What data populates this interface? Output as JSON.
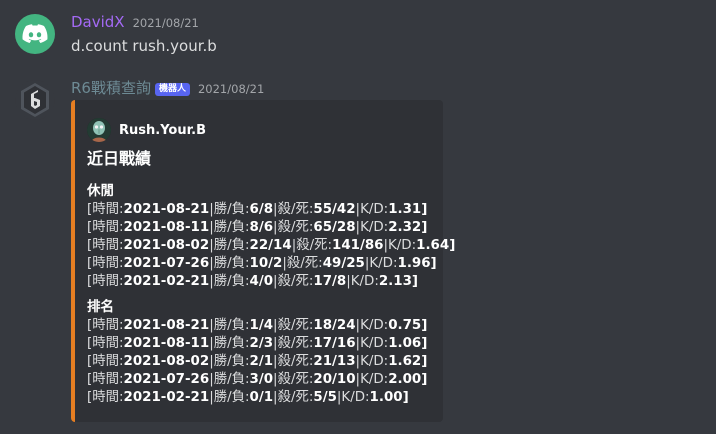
{
  "messages": [
    {
      "username": "DavidX",
      "username_color": "#a46af5",
      "timestamp": "2021/08/21",
      "content": "d.count rush.your.b",
      "avatar_icon": "discord-logo-icon"
    },
    {
      "username": "R6戰積查詢",
      "username_color": "#6d8a94",
      "bot_tag": "機器人",
      "timestamp": "2021/08/21",
      "avatar_icon": "rainbow-six-logo-icon",
      "embed": {
        "accent_color": "#e67e22",
        "author_name": "Rush.Your.B",
        "author_icon": "squidward-avatar-icon",
        "title": "近日戰績",
        "fields": [
          {
            "name": "休閒",
            "rows": [
              {
                "date": "2021-08-21",
                "wl": "6/8",
                "kd_ratio": "55/42",
                "kd": "1.31"
              },
              {
                "date": "2021-08-11",
                "wl": "8/6",
                "kd_ratio": "65/28",
                "kd": "2.32"
              },
              {
                "date": "2021-08-02",
                "wl": "22/14",
                "kd_ratio": "141/86",
                "kd": "1.64"
              },
              {
                "date": "2021-07-26",
                "wl": "10/2",
                "kd_ratio": "49/25",
                "kd": "1.96"
              },
              {
                "date": "2021-02-21",
                "wl": "4/0",
                "kd_ratio": "17/8",
                "kd": "2.13"
              }
            ]
          },
          {
            "name": "排名",
            "rows": [
              {
                "date": "2021-08-21",
                "wl": "1/4",
                "kd_ratio": "18/24",
                "kd": "0.75"
              },
              {
                "date": "2021-08-11",
                "wl": "2/3",
                "kd_ratio": "17/16",
                "kd": "1.06"
              },
              {
                "date": "2021-08-02",
                "wl": "2/1",
                "kd_ratio": "21/13",
                "kd": "1.62"
              },
              {
                "date": "2021-07-26",
                "wl": "3/0",
                "kd_ratio": "20/10",
                "kd": "2.00"
              },
              {
                "date": "2021-02-21",
                "wl": "0/1",
                "kd_ratio": "5/5",
                "kd": "1.00"
              }
            ]
          }
        ]
      }
    }
  ],
  "row_labels": {
    "open": "[",
    "time": "時間:",
    "sep": "|",
    "wl": "勝/負:",
    "kdr": "殺/死:",
    "kd": "K/D:",
    "close": "]"
  }
}
